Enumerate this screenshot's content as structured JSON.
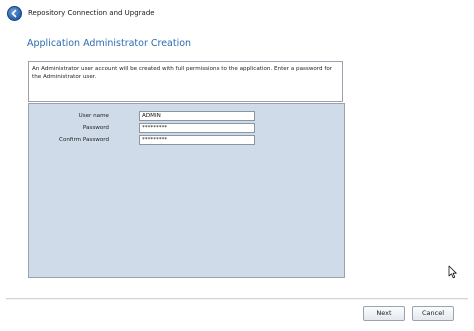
{
  "window": {
    "title": "Repository Connection and Upgrade"
  },
  "page": {
    "title": "Application Administrator Creation",
    "info": "An Administrator user account will be created with full permissions to the application. Enter a password for the Administrator user."
  },
  "form": {
    "username_label": "User name",
    "username_value": "ADMIN",
    "password_label": "Password",
    "password_value": "*********",
    "confirm_label": "Confirm Password",
    "confirm_value": "*********"
  },
  "buttons": {
    "next": "Next",
    "cancel": "Cancel"
  },
  "colors": {
    "title_accent": "#2b6cb0",
    "panel_bg": "#cfdbe8"
  }
}
